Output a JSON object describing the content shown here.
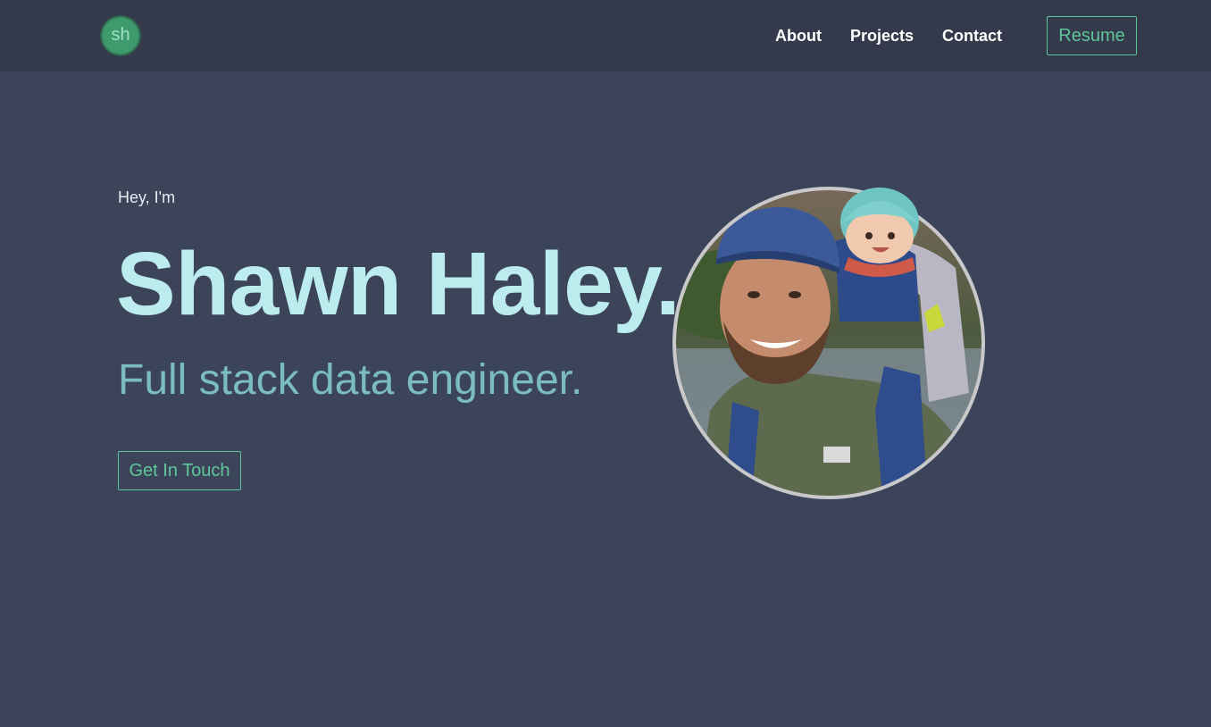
{
  "nav": {
    "logo_text": "sh",
    "links": [
      "About",
      "Projects",
      "Contact"
    ],
    "resume_label": "Resume"
  },
  "hero": {
    "intro": "Hey, I'm",
    "name": "Shawn Haley.",
    "tagline": "Full stack data engineer.",
    "cta_label": "Get In Touch"
  },
  "colors": {
    "background": "#3b4459",
    "navbar": "#343a4c",
    "accent": "#5fc59a",
    "name": "#bcecee",
    "tagline": "#7bbcc4"
  }
}
